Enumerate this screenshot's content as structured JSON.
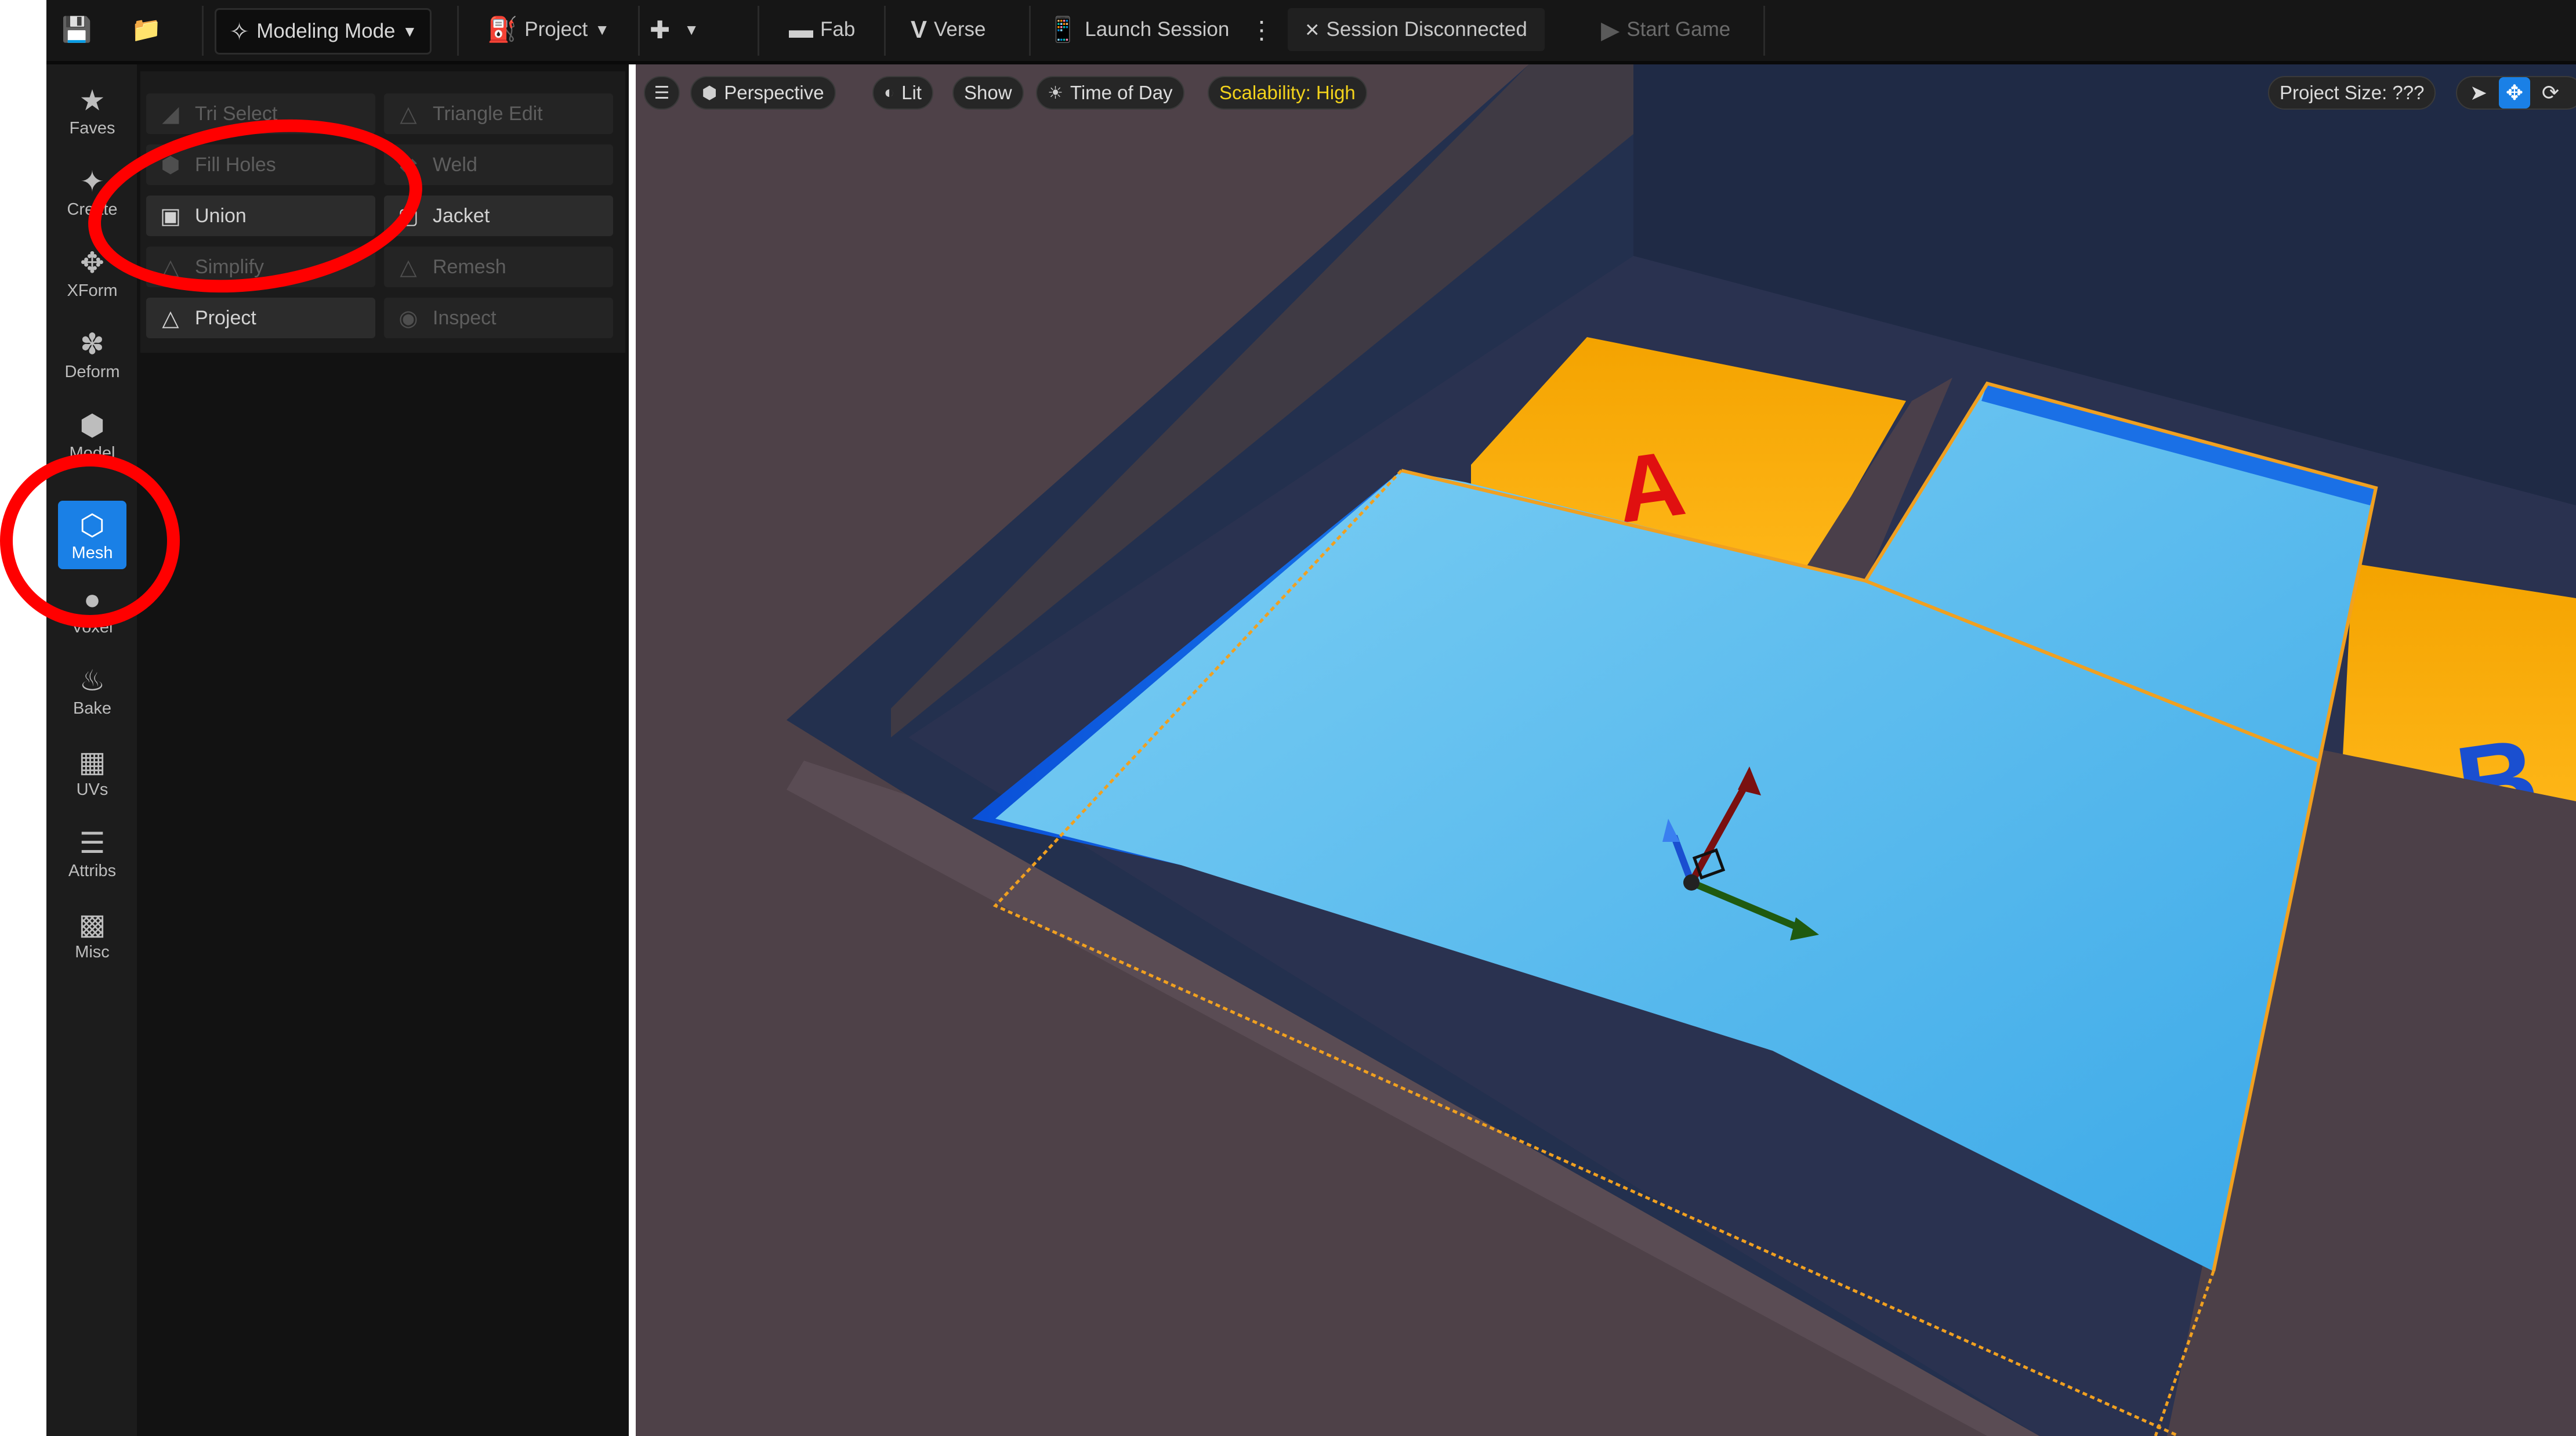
{
  "toolbar": {
    "mode_label": "Modeling Mode",
    "project_label": "Project",
    "fab_label": "Fab",
    "verse_label": "Verse",
    "launch_label": "Launch Session",
    "session_label": "Session Disconnected",
    "start_label": "Start Game",
    "icons": [
      "save-icon",
      "content-browser-icon",
      "modeling-mode-icon",
      "project-icon",
      "add-actor-icon",
      "fab-icon",
      "verse-icon",
      "launch-session-icon",
      "more-options-icon",
      "session-status-icon",
      "play-icon"
    ]
  },
  "rail": {
    "items": [
      {
        "label": "Faves",
        "icon": "star-icon"
      },
      {
        "label": "Create",
        "icon": "create-icon"
      },
      {
        "label": "XForm",
        "icon": "transform-icon"
      },
      {
        "label": "Deform",
        "icon": "deform-icon"
      },
      {
        "label": "Model",
        "icon": "model-icon"
      },
      {
        "label": "Mesh",
        "icon": "mesh-icon",
        "active": true
      },
      {
        "label": "Voxel",
        "icon": "voxel-icon"
      },
      {
        "label": "Bake",
        "icon": "bake-icon"
      },
      {
        "label": "UVs",
        "icon": "uvs-icon"
      },
      {
        "label": "Attribs",
        "icon": "attribs-icon"
      },
      {
        "label": "Misc",
        "icon": "misc-icon"
      }
    ]
  },
  "palette": {
    "tools": [
      {
        "label": "Tri Select",
        "enabled": false
      },
      {
        "label": "Triangle Edit",
        "enabled": false
      },
      {
        "label": "Fill Holes",
        "enabled": false
      },
      {
        "label": "Weld",
        "enabled": false
      },
      {
        "label": "Union",
        "enabled": true
      },
      {
        "label": "Jacket",
        "enabled": true
      },
      {
        "label": "Simplify",
        "enabled": false
      },
      {
        "label": "Remesh",
        "enabled": false
      },
      {
        "label": "Project",
        "enabled": true
      },
      {
        "label": "Inspect",
        "enabled": false
      }
    ]
  },
  "viewport": {
    "perspective_label": "Perspective",
    "lit_label": "Lit",
    "show_label": "Show",
    "time_label": "Time of Day",
    "scalability_label": "Scalability: High",
    "project_size_label": "Project Size: ???",
    "scene_label_a": "A",
    "scene_label_b": "B",
    "colors": {
      "accent_blue": "#1a80e6",
      "selection_orange": "#f0a020",
      "annotation_red": "#ff0000",
      "scalability_yellow": "#f2d21b"
    }
  }
}
